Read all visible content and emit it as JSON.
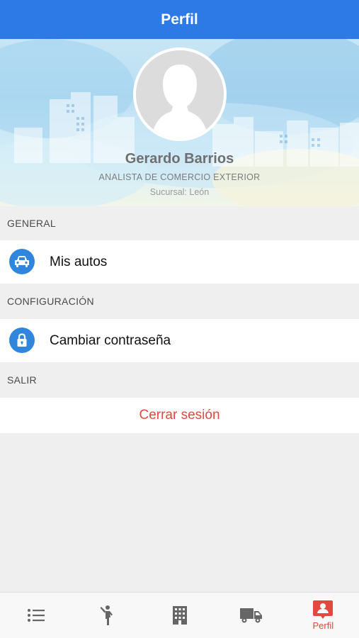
{
  "navbar": {
    "title": "Perfil"
  },
  "profile": {
    "name": "Gerardo Barrios",
    "role": "ANALISTA DE COMERCIO EXTERIOR",
    "branch": "Sucursal: León"
  },
  "sections": {
    "general": {
      "title": "GENERAL",
      "item_label": "Mis autos",
      "item_icon": "car-icon"
    },
    "config": {
      "title": "CONFIGURACIÓN",
      "item_label": "Cambiar contraseña",
      "item_icon": "lock-icon"
    },
    "exit": {
      "title": "SALIR",
      "item_label": "Cerrar sesión"
    }
  },
  "tabbar": {
    "tabs": [
      {
        "icon": "list-icon",
        "label": ""
      },
      {
        "icon": "person-walking-icon",
        "label": ""
      },
      {
        "icon": "building-icon",
        "label": ""
      },
      {
        "icon": "truck-icon",
        "label": ""
      },
      {
        "icon": "profile-badge-icon",
        "label": "Perfil",
        "active": true
      }
    ]
  },
  "colors": {
    "navbar": "#2d7ae6",
    "icon_circle": "#2f86dc",
    "destructive": "#e2483d",
    "tab_inactive": "#666666",
    "tab_active": "#e2483d"
  }
}
